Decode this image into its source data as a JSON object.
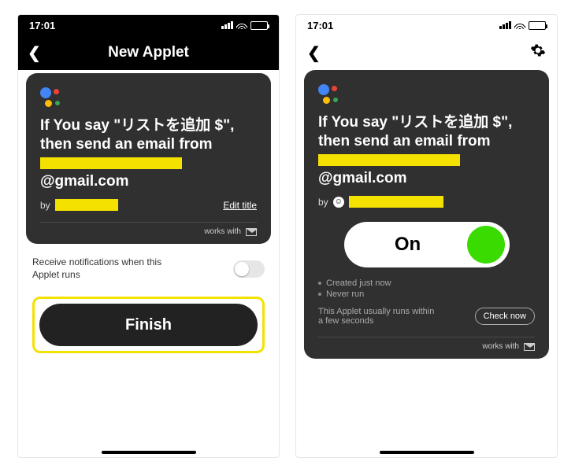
{
  "status": {
    "time": "17:01"
  },
  "left": {
    "title": "New Applet",
    "applet_text_prefix": "If You say \"リストを追加 $\", then send an email from",
    "applet_text_suffix": "@gmail.com",
    "by_label": "by",
    "edit_title": "Edit title",
    "works_with": "works with",
    "notif_text": "Receive notifications when this Applet runs",
    "finish": "Finish"
  },
  "right": {
    "applet_text_prefix": "If You say \"リストを追加 $\", then send an email from",
    "applet_text_suffix": "@gmail.com",
    "by_label": "by",
    "toggle_label": "On",
    "meta_created": "Created just now",
    "meta_never": "Never run",
    "meta_hint": "This Applet usually runs within a few seconds",
    "check_now": "Check now",
    "works_with": "works with"
  }
}
